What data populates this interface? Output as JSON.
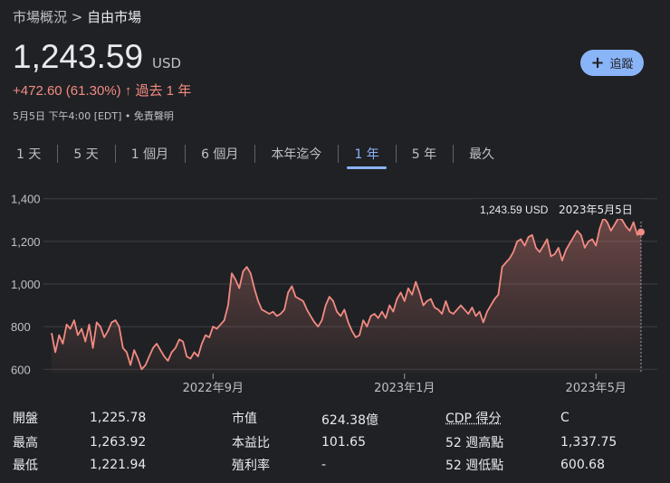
{
  "breadcrumb": {
    "parent": "市場概況",
    "separator": ">",
    "current": "自由市場"
  },
  "quote": {
    "price": "1,243.59",
    "currency": "USD",
    "change": "+472.60 (61.30%)",
    "arrow": "↑",
    "period": "過去 1 年",
    "meta": "5月5日 下午4:00 [EDT] • 免責聲明"
  },
  "follow_button": {
    "icon": "plus-icon",
    "label": "追蹤"
  },
  "tabs": [
    {
      "label": "1 天",
      "active": false
    },
    {
      "label": "5 天",
      "active": false
    },
    {
      "label": "1 個月",
      "active": false
    },
    {
      "label": "6 個月",
      "active": false
    },
    {
      "label": "本年迄今",
      "active": false
    },
    {
      "label": "1 年",
      "active": true
    },
    {
      "label": "5 年",
      "active": false
    },
    {
      "label": "最久",
      "active": false
    }
  ],
  "colors": {
    "line": "#f28b82",
    "accent": "#8ab4f8",
    "background": "#202124",
    "grid": "#3c4043"
  },
  "chart_data": {
    "type": "line",
    "title": "",
    "xlabel": "",
    "ylabel": "",
    "ylim": [
      580,
      1420
    ],
    "y_ticks": [
      600,
      800,
      1000,
      1200,
      1400
    ],
    "y_tick_labels": [
      "600",
      "800",
      "1,000",
      "1,200",
      "1,400"
    ],
    "x_ticks": [
      {
        "label": "2022年9月",
        "index": 43
      },
      {
        "label": "2023年1月",
        "index": 94
      },
      {
        "label": "2023年5月",
        "index": 145
      }
    ],
    "tooltip": {
      "value": "1,243.59 USD",
      "date": "2023年5月5日"
    },
    "series": [
      {
        "values": [
          770,
          680,
          760,
          720,
          810,
          790,
          830,
          760,
          790,
          730,
          810,
          700,
          820,
          800,
          750,
          780,
          820,
          830,
          800,
          700,
          680,
          620,
          690,
          650,
          600,
          620,
          660,
          700,
          720,
          690,
          660,
          640,
          680,
          700,
          740,
          730,
          660,
          650,
          680,
          660,
          720,
          760,
          750,
          800,
          790,
          810,
          830,
          900,
          1050,
          1020,
          980,
          1060,
          1080,
          1050,
          980,
          920,
          880,
          870,
          860,
          870,
          850,
          860,
          880,
          960,
          990,
          940,
          930,
          920,
          880,
          850,
          820,
          800,
          830,
          900,
          940,
          920,
          870,
          850,
          880,
          820,
          780,
          750,
          760,
          830,
          800,
          850,
          860,
          840,
          870,
          840,
          900,
          870,
          930,
          960,
          920,
          980,
          950,
          1010,
          960,
          900,
          920,
          930,
          890,
          880,
          860,
          920,
          870,
          860,
          880,
          900,
          880,
          860,
          890,
          850,
          870,
          820,
          870,
          900,
          930,
          950,
          1080,
          1100,
          1120,
          1150,
          1200,
          1210,
          1180,
          1220,
          1230,
          1170,
          1150,
          1180,
          1210,
          1130,
          1140,
          1170,
          1110,
          1160,
          1190,
          1220,
          1250,
          1230,
          1170,
          1200,
          1210,
          1180,
          1260,
          1310,
          1290,
          1250,
          1280,
          1310,
          1300,
          1270,
          1250,
          1290,
          1230,
          1243.59
        ]
      }
    ]
  },
  "stats": {
    "left": [
      {
        "label": "開盤",
        "value": "1,225.78"
      },
      {
        "label": "最高",
        "value": "1,263.92"
      },
      {
        "label": "最低",
        "value": "1,221.94"
      }
    ],
    "middle": [
      {
        "label": "市值",
        "value": "624.38億"
      },
      {
        "label": "本益比",
        "value": "101.65"
      },
      {
        "label": "殖利率",
        "value": "-"
      }
    ],
    "right": [
      {
        "label": "CDP 得分",
        "value": "C"
      },
      {
        "label": "52 週高點",
        "value": "1,337.75"
      },
      {
        "label": "52 週低點",
        "value": "600.68"
      }
    ]
  }
}
